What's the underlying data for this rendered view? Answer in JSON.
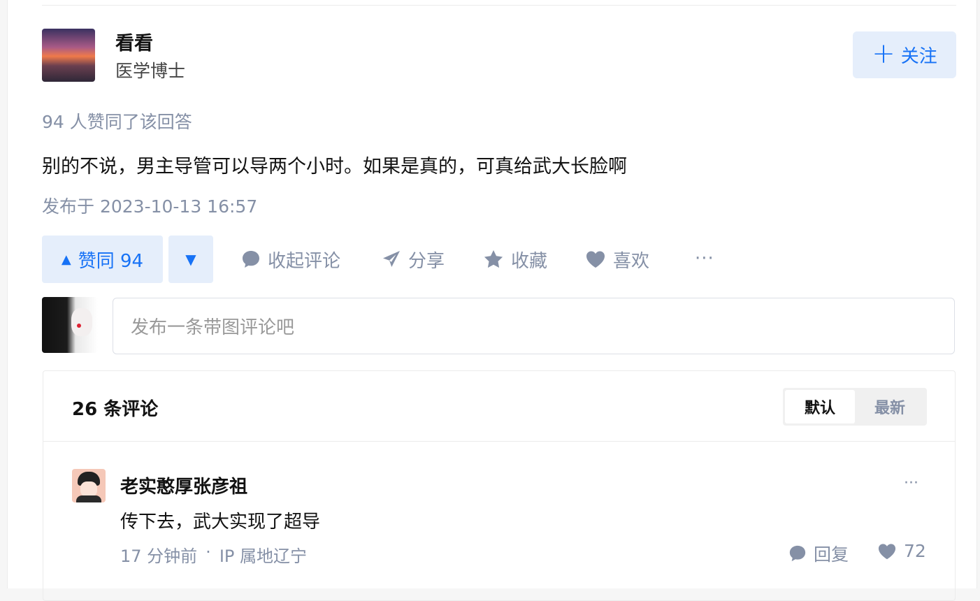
{
  "author": {
    "name": "看看",
    "bio": "医学博士",
    "follow_label": "关注"
  },
  "answer": {
    "vote_summary": "94 人赞同了该回答",
    "content": "别的不说，男主导管可以导两个小时。如果是真的，可真给武大长脸啊",
    "publish_time": "发布于 2023-10-13 16:57"
  },
  "actions": {
    "upvote_label": "赞同 94",
    "collapse_comments": "收起评论",
    "share": "分享",
    "favorite": "收藏",
    "like": "喜欢",
    "more": "···"
  },
  "comment_input": {
    "placeholder": "发布一条带图评论吧"
  },
  "comments": {
    "count_label": "26 条评论",
    "sort_default": "默认",
    "sort_latest": "最新",
    "items": [
      {
        "name": "老实憨厚张彦祖",
        "text": "传下去，武大实现了超导",
        "time": "17 分钟前",
        "separator": "·",
        "ip": "IP 属地辽宁",
        "reply_label": "回复",
        "likes": "72",
        "more": "···"
      }
    ]
  },
  "icons": {
    "plus": "plus-icon",
    "upvote": "triangle-up-icon",
    "downvote": "triangle-down-icon",
    "comment": "comment-bubble-icon",
    "share": "paper-plane-icon",
    "favorite": "star-icon",
    "like": "heart-icon"
  },
  "colors": {
    "accent": "#1772f6",
    "accent_bg": "#e5eefb",
    "muted": "#8590a6"
  }
}
